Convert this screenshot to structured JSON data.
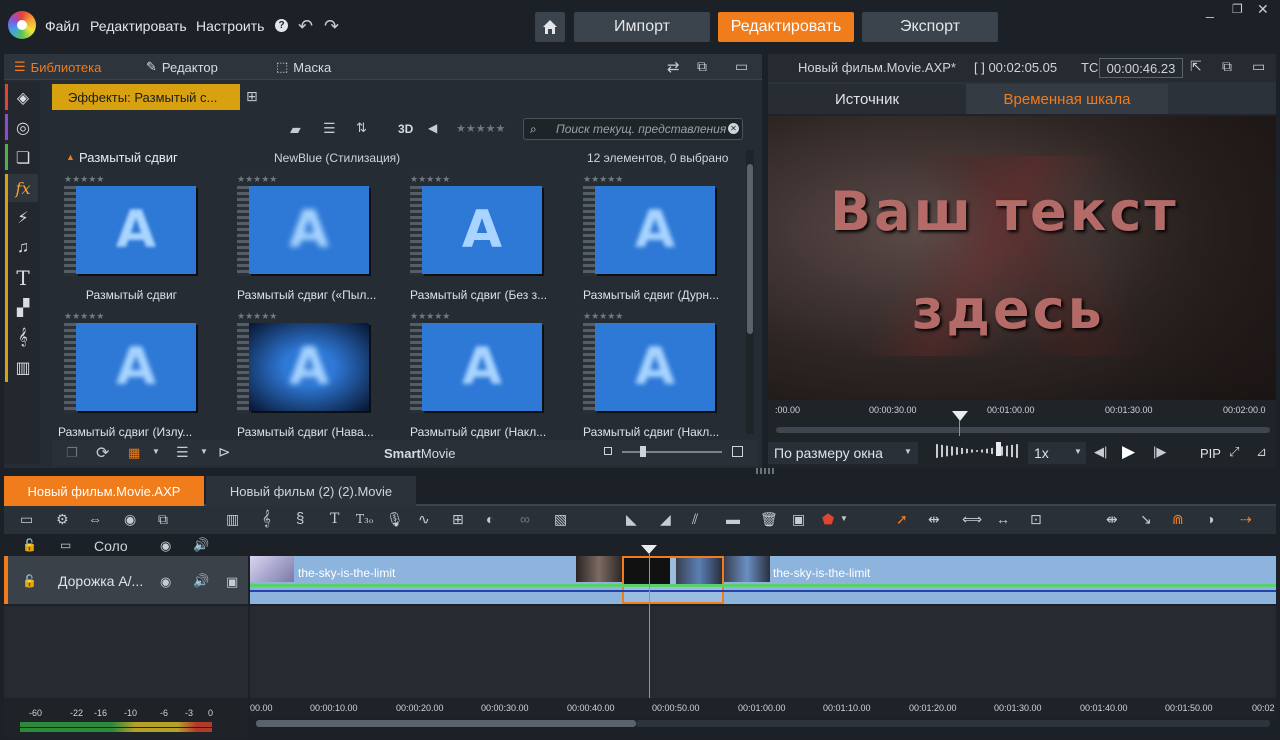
{
  "menu": {
    "file": "Файл",
    "edit": "Редактировать",
    "setup": "Настроить",
    "help": "?"
  },
  "topbar": {
    "import": "Импорт",
    "edit": "Редактировать",
    "export": "Экспорт"
  },
  "library_tabs": {
    "library": "Библиотека",
    "editor": "Редактор",
    "mask": "Маска"
  },
  "effects_tab": "Эффекты: Размытый с...",
  "search_placeholder": "Поиск текущ. представления",
  "toolbar_3d": "3D",
  "group": {
    "title": "Размытый сдвиг",
    "subtitle": "NewBlue (Стилизация)",
    "count": "12 элементов, 0 выбрано"
  },
  "effects": [
    {
      "label": "Размытый сдвиг",
      "stars": "★★★★★"
    },
    {
      "label": "Размытый сдвиг («Пыл...",
      "stars": "★★★★★"
    },
    {
      "label": "Размытый сдвиг (Без з...",
      "stars": "★★★★★"
    },
    {
      "label": "Размытый сдвиг (Дурн...",
      "stars": "★★★★★"
    },
    {
      "label": "Размытый сдвиг (Излу...",
      "stars": "★★★★★"
    },
    {
      "label": "Размытый сдвиг (Нава...",
      "stars": "★★★★★"
    },
    {
      "label": "Размытый сдвиг (Накл...",
      "stars": "★★★★★"
    },
    {
      "label": "Размытый сдвиг (Накл...",
      "stars": "★★★★★"
    }
  ],
  "thumb_letter": "A",
  "smartmovie": {
    "bold": "Smart",
    "normal": "Movie"
  },
  "preview": {
    "project": "Новый фильм.Movie.AXP*",
    "duration_label": "[ ] 00:02:05.05",
    "tc_label": "TC",
    "timecode": "00:00:46.23",
    "tab_source": "Источник",
    "tab_timeline": "Временная шкала",
    "video_text_line1": "Ваш текст",
    "video_text_line2": "здесь",
    "ruler": [
      ":00.00",
      "00:00:30.00",
      "00:01:00.00",
      "00:01:30.00",
      "00:02:00.0"
    ],
    "fit": "По размеру окна",
    "speed": "1x",
    "pip": "PIP"
  },
  "timeline": {
    "tab_active": "Новый фильм.Movie.AXP",
    "tab_other": "Новый фильм (2) (2).Movie",
    "solo": "Соло",
    "track_name": "Дорожка А/...",
    "clip1": "the-sky-is-the-limit",
    "clip2": "the-sky-is-the-limit",
    "ruler": [
      "00.00",
      "00:00:10.00",
      "00:00:20.00",
      "00:00:30.00",
      "00:00:40.00",
      "00:00:50.00",
      "00:01:00.00",
      "00:01:10.00",
      "00:01:20.00",
      "00:01:30.00",
      "00:01:40.00",
      "00:01:50.00",
      "00:02"
    ],
    "meter_scale": [
      "-60",
      "-22",
      "-16",
      "-10",
      "-6",
      "-3",
      "0"
    ]
  },
  "colors": {
    "accent": "#f07c1b",
    "effects_tab": "#d7a10f",
    "thumb": "#2e78d6"
  }
}
